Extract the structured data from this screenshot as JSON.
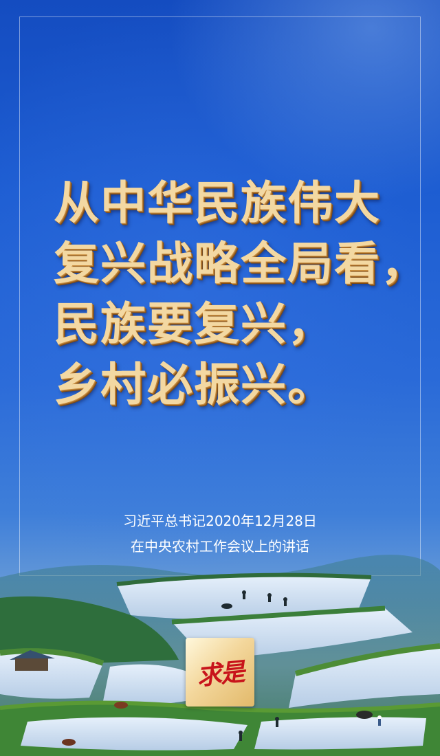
{
  "quote": {
    "lines": [
      "从中华民族伟大",
      "复兴战略全局看，",
      "民族要复兴，",
      "乡村必振兴。"
    ]
  },
  "caption": {
    "lines": [
      "习近平总书记2020年12月28日",
      "在中央农村工作会议上的讲话"
    ]
  },
  "logo": {
    "text": "求是",
    "text_color": "#c8141b",
    "background": "#f3d79c"
  },
  "colors": {
    "sky": "#1f57c6",
    "quote_gold": "#f3d8a2",
    "frame": "#ffffff"
  },
  "landscape": {
    "subject": "rice-terraces-icon"
  }
}
